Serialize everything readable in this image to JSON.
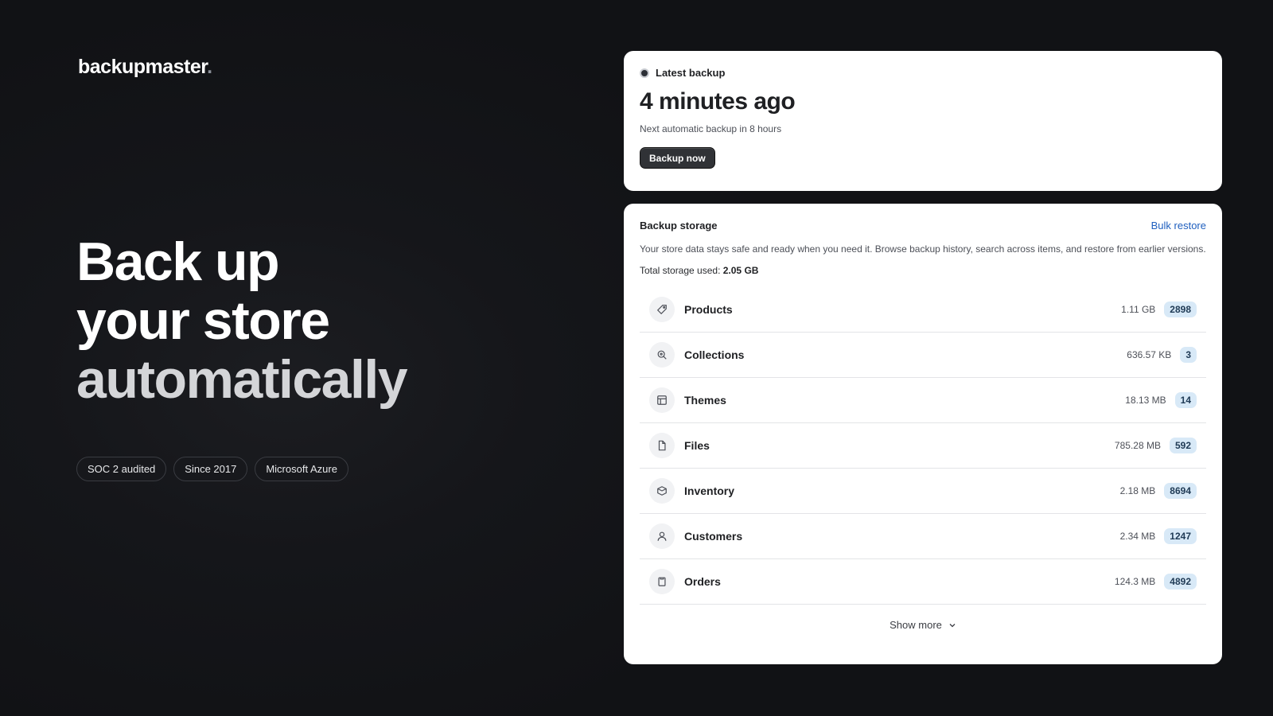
{
  "brand": {
    "name": "backupmaster",
    "dot": "."
  },
  "hero": {
    "line1": "Back up",
    "line2": "your store",
    "line3": "automatically"
  },
  "badges": [
    "SOC 2 audited",
    "Since 2017",
    "Microsoft Azure"
  ],
  "latest_backup": {
    "label": "Latest backup",
    "value": "4 minutes ago",
    "next": "Next automatic backup in 8 hours",
    "button": "Backup now"
  },
  "storage": {
    "title": "Backup storage",
    "bulk_restore": "Bulk restore",
    "description": "Your store data stays safe and ready when you need it. Browse backup history, search across items, and restore from earlier versions.",
    "total_label": "Total storage used:",
    "total_value": "2.05 GB",
    "items": [
      {
        "name": "Products",
        "size": "1.11 GB",
        "count": "2898",
        "icon": "tag-icon"
      },
      {
        "name": "Collections",
        "size": "636.57 KB",
        "count": "3",
        "icon": "search-icon"
      },
      {
        "name": "Themes",
        "size": "18.13 MB",
        "count": "14",
        "icon": "layout-icon"
      },
      {
        "name": "Files",
        "size": "785.28 MB",
        "count": "592",
        "icon": "file-icon"
      },
      {
        "name": "Inventory",
        "size": "2.18 MB",
        "count": "8694",
        "icon": "box-icon"
      },
      {
        "name": "Customers",
        "size": "2.34 MB",
        "count": "1247",
        "icon": "user-icon"
      },
      {
        "name": "Orders",
        "size": "124.3 MB",
        "count": "4892",
        "icon": "order-icon"
      }
    ],
    "show_more": "Show more"
  },
  "colors": {
    "accent_link": "#1f5fbf",
    "badge_bg": "#d8e9f7",
    "page_bg": "#111215"
  }
}
